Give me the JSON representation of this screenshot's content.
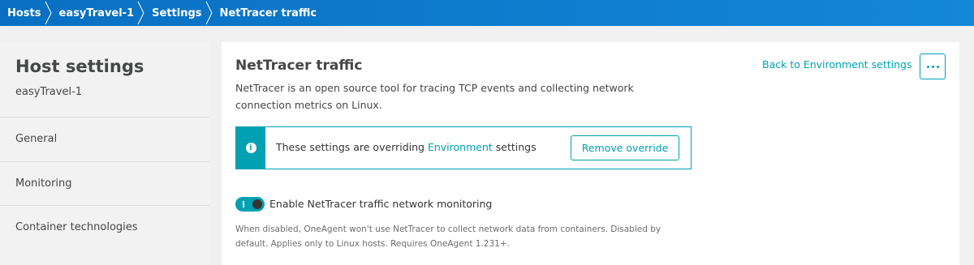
{
  "breadcrumb": {
    "items": [
      {
        "label": "Hosts"
      },
      {
        "label": "easyTravel-1"
      },
      {
        "label": "Settings"
      },
      {
        "label": "NetTracer traffic"
      }
    ]
  },
  "sidebar": {
    "title": "Host settings",
    "subtitle": "easyTravel-1",
    "items": [
      {
        "label": "General"
      },
      {
        "label": "Monitoring"
      },
      {
        "label": "Container technologies"
      }
    ]
  },
  "main": {
    "title": "NetTracer traffic",
    "description": "NetTracer is an open source tool for tracing TCP events and collecting network connection metrics on Linux.",
    "back_link": "Back to Environment settings",
    "more_icon": "more-horizontal-icon",
    "notice": {
      "icon": "info-icon",
      "text_before": "These settings are overriding ",
      "link": "Environment",
      "text_after": " settings",
      "button": "Remove override"
    },
    "toggle": {
      "label": "Enable NetTracer traffic network monitoring",
      "state": "on",
      "help": "When disabled, OneAgent won't use NetTracer to collect network data from containers. Disabled by default. Applies only to Linux hosts. Requires OneAgent 1.231+."
    }
  },
  "colors": {
    "header_blue": "#0a6fc2",
    "accent_teal": "#00a1b2"
  }
}
